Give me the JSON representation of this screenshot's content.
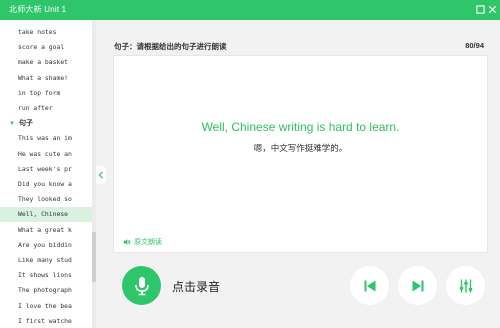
{
  "window": {
    "title": "北师大新 Unit 1"
  },
  "sidebar": {
    "items_before": [
      "take notes",
      "score a goal",
      "make a basket",
      "What a shame!",
      "in top form",
      "run after"
    ],
    "group_label": "句子",
    "items_after": [
      "This was an im",
      "He was cute an",
      "Last week's pr",
      "Did you know a",
      "They looked so",
      "Well, Chinese",
      "What a great k",
      "Are you biddin",
      "Like many stud",
      "It shows lions",
      "The photograph",
      "I love the bea",
      "I first watche"
    ],
    "active_item": "Well, Chinese"
  },
  "main": {
    "prompt": "句子：请根据给出的句子进行朗读",
    "progress": "80/94",
    "sentence_en": "Well, Chinese writing is hard to learn.",
    "sentence_cn": "嗯，中文写作挺难学的。",
    "original_audio_label": "原文朗读",
    "record_label": "点击录音"
  },
  "colors": {
    "accent": "#2fc56a",
    "sentence": "#2fbf5f",
    "active_row": "#d8f2df"
  },
  "icons": [
    "minimize-icon",
    "close-icon",
    "chevron-left-icon",
    "speaker-icon",
    "microphone-icon",
    "skip-previous-icon",
    "skip-next-icon",
    "sliders-icon"
  ]
}
